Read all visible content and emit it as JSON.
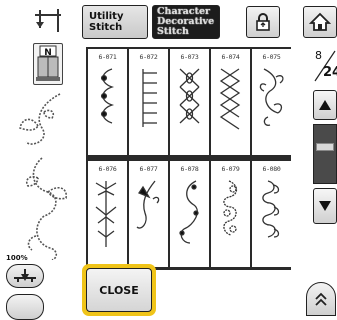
{
  "tabs": {
    "utility": [
      "Utility",
      "Stitch"
    ],
    "character": [
      "Character",
      "Decorative",
      "Stitch"
    ]
  },
  "stitches": {
    "row1": [
      "6-071",
      "6-072",
      "6-073",
      "6-074",
      "6-075"
    ],
    "row2": [
      "6-076",
      "6-077",
      "6-078",
      "6-079",
      "6-080"
    ]
  },
  "page": {
    "current": "8",
    "total": "24"
  },
  "zoom_label": "100%",
  "close_label": "CLOSE",
  "colors": {
    "highlight": "#f0c419",
    "grid_border": "#2a2a2a",
    "active_tab": "#1c1c1c"
  },
  "icons": [
    "needle-position-icon",
    "presser-foot-n-icon",
    "lock-icon",
    "home-icon",
    "scroll-up-icon",
    "scroll-down-icon",
    "needle-down-icon",
    "expand-icon"
  ]
}
